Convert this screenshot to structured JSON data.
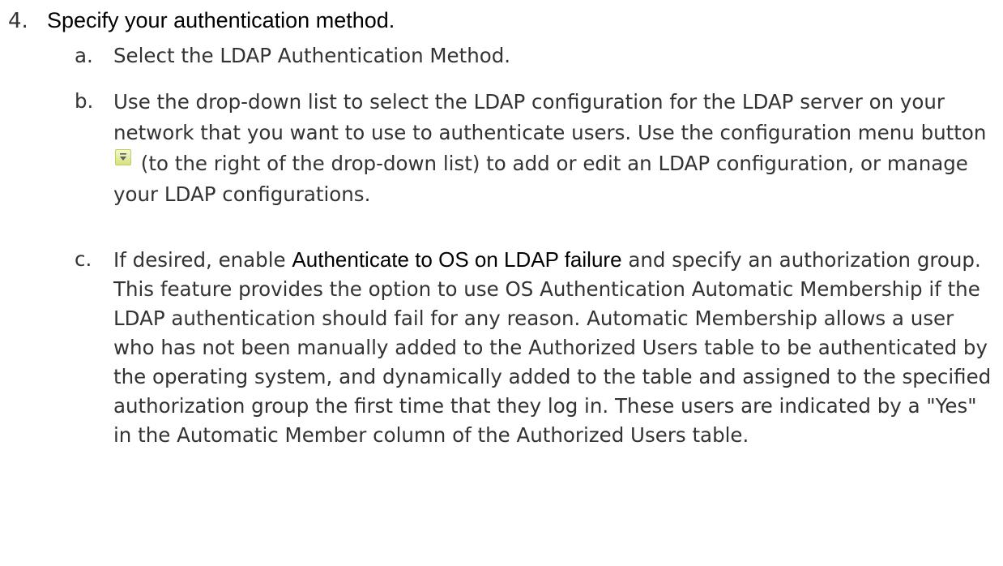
{
  "step": {
    "number": "4.",
    "title": "Specify your authentication method."
  },
  "substeps": {
    "a": {
      "letter": "a.",
      "text": "Select the LDAP Authentication Method."
    },
    "b": {
      "letter": "b.",
      "text_before_icon": "Use the drop-down list to select the LDAP configuration for the LDAP server on your network that you want to use to authenticate users. Use the configuration menu button",
      "icon": "configuration-menu-button-icon",
      "text_after_icon": "(to the right of the drop-down list) to add or edit an LDAP configuration, or manage your LDAP configurations."
    },
    "c": {
      "letter": "c.",
      "text_before_emph": "If desired, enable",
      "emph": "Authenticate to OS on LDAP failure",
      "text_after_emph": "and specify an authorization group. This feature provides the option to use OS Authentication Automatic Membership if the LDAP authentication should fail for any reason. Automatic Membership allows a user who has not been manually added to the Authorized Users table to be authenticated by the operating system, and dynamically added to the table and assigned to the specified authorization group the first time that they log in. These users are indicated by a \"Yes\" in the Automatic Member column of the Authorized Users table."
    }
  },
  "colors": {
    "text": "#333333",
    "emphasis": "#000000",
    "icon_fill": "#d6e27a"
  }
}
